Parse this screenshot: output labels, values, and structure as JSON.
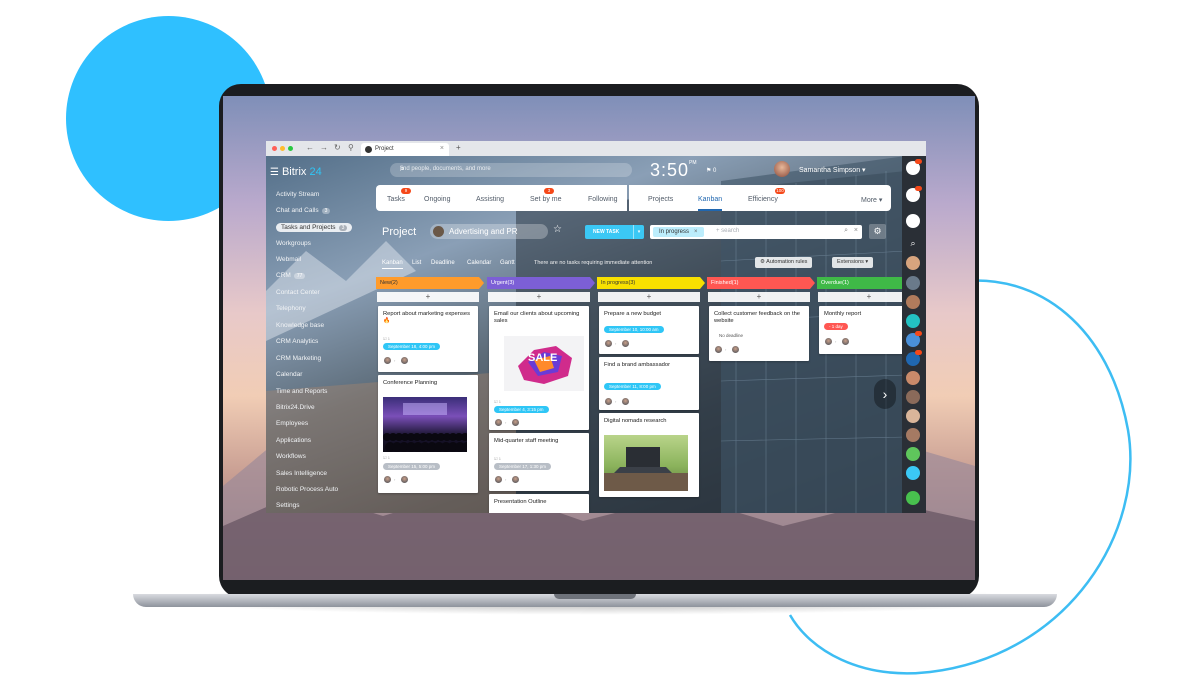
{
  "browser": {
    "tab_title": "Project",
    "new_tab_symbol": "+"
  },
  "header": {
    "logo_main": "Bitrix",
    "logo_num": "24",
    "search_placeholder": "find people, documents, and more",
    "clock": "3:50",
    "clock_suffix": "PM",
    "flag_count": "0",
    "user_name": "Samantha Simpson"
  },
  "sidebar": {
    "items": [
      {
        "label": "Activity Stream"
      },
      {
        "label": "Chat and Calls",
        "count": "3"
      },
      {
        "label": "Tasks and Projects",
        "count": "3"
      },
      {
        "label": "Workgroups"
      },
      {
        "label": "Webmail"
      },
      {
        "label": "CRM",
        "count": "77"
      },
      {
        "label": "Contact Center"
      },
      {
        "label": "Telephony"
      },
      {
        "label": "Knowledge base"
      },
      {
        "label": "CRM Analytics"
      },
      {
        "label": "CRM Marketing"
      },
      {
        "label": "Calendar"
      },
      {
        "label": "Time and Reports"
      },
      {
        "label": "Bitrix24.Drive"
      },
      {
        "label": "Employees"
      },
      {
        "label": "Applications"
      },
      {
        "label": "Workflows"
      },
      {
        "label": "Sales Intelligence"
      },
      {
        "label": "Robotic Process Auto"
      },
      {
        "label": "Settings"
      }
    ]
  },
  "top_tabs": {
    "left": [
      {
        "label": "Tasks",
        "badge": "9"
      },
      {
        "label": "Ongoing"
      },
      {
        "label": "Assisting"
      },
      {
        "label": "Set by me",
        "badge": "3"
      },
      {
        "label": "Following"
      }
    ],
    "right": [
      {
        "label": "Projects"
      },
      {
        "label": "Kanban"
      },
      {
        "label": "Efficiency",
        "badge": "100"
      },
      {
        "label": "More"
      }
    ]
  },
  "project_bar": {
    "title": "Project",
    "project_name": "Advertising and PR",
    "new_task_label": "NEW TASK",
    "filter_chip": "In progress",
    "search_placeholder": "+ search"
  },
  "views": {
    "tabs": [
      "Kanban",
      "List",
      "Deadline",
      "Calendar",
      "Gantt"
    ],
    "note": "There are no tasks requiring immediate attention",
    "automation_label": "Automation rules",
    "extensions_label": "Extensions"
  },
  "colors": {
    "new": "#ff9b2b",
    "urgent": "#7c5fd6",
    "in_progress": "#f8e000",
    "finished": "#ff5752",
    "overdue": "#3fb947",
    "accent": "#2fc6f6"
  },
  "kanban": {
    "columns": [
      {
        "title": "New",
        "count": "(2)",
        "cards": [
          {
            "title": "Report about marketing expenses 🔥",
            "deadline": "September 18, 4:00 pm",
            "deadline_style": "blue"
          },
          {
            "title": "Conference Planning",
            "deadline": "September 15, 5:00 pm",
            "deadline_style": "gray"
          }
        ]
      },
      {
        "title": "Urgent",
        "count": "(3)",
        "cards": [
          {
            "title": "Email our clients about upcoming sales",
            "image_text": "SALE",
            "deadline": "September 4, 3:15 pm",
            "deadline_style": "blue"
          },
          {
            "title": "Mid-quarter staff meeting",
            "deadline": "September 17, 1:30 pm",
            "deadline_style": "gray"
          },
          {
            "title": "Presentation Outline"
          }
        ]
      },
      {
        "title": "In progress",
        "count": "(3)",
        "cards": [
          {
            "title": "Prepare a new budget",
            "deadline": "September 10, 10:00 am",
            "deadline_style": "blue"
          },
          {
            "title": "Find a brand ambassador",
            "deadline": "September 11, 8:00 pm",
            "deadline_style": "blue"
          },
          {
            "title": "Digital nomads research"
          }
        ]
      },
      {
        "title": "Finished",
        "count": "(1)",
        "cards": [
          {
            "title": "Collect customer feedback on the website",
            "deadline": "No deadline",
            "deadline_style": "none"
          }
        ]
      },
      {
        "title": "Overdue",
        "count": "(1)",
        "cards": [
          {
            "title": "Monthly report",
            "deadline": "- 1 day",
            "deadline_style": "red"
          }
        ]
      }
    ]
  }
}
